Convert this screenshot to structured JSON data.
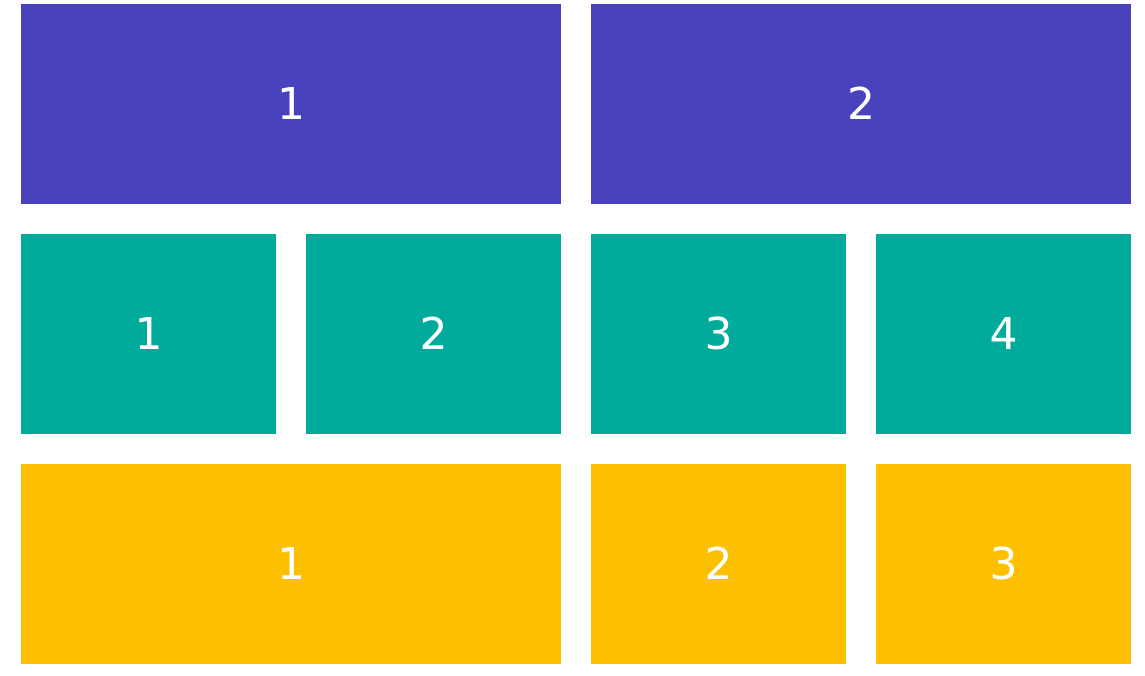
{
  "colors": {
    "row_1": "#4842bc",
    "row_2": "#00ab9c",
    "row_3": "#fdc000",
    "text": "#ffffff"
  },
  "rows": [
    {
      "cells": [
        {
          "label": "1"
        },
        {
          "label": "2"
        }
      ]
    },
    {
      "cells": [
        {
          "label": "1"
        },
        {
          "label": "2"
        },
        {
          "label": "3"
        },
        {
          "label": "4"
        }
      ]
    },
    {
      "cells": [
        {
          "label": "1"
        },
        {
          "label": "2"
        },
        {
          "label": "3"
        }
      ]
    }
  ]
}
